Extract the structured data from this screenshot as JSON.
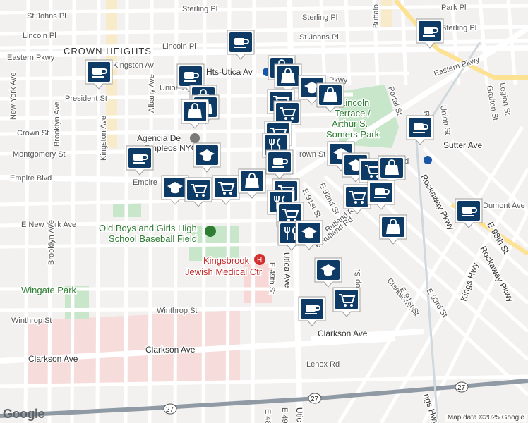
{
  "map": {
    "neighborhood": "CROWN HEIGHTS",
    "streets": {
      "sterling_1": "Sterling Pl",
      "sterling_2": "Sterling Pl",
      "sterling_3": "Sterling Pl",
      "st_johns_1": "St Johns Pl",
      "st_johns_2": "St Johns Pl",
      "lincoln_1": "Lincoln Pl",
      "lincoln_2": "Lincoln Pl",
      "eastern_pkwy_1": "Eastern Pkwy",
      "eastern_pkwy_2": "Eastern Pkwy",
      "eastern_pkwy_3": "Pkwy",
      "kingston_av": "Kingston Av",
      "union_1": "Union S",
      "president": "President St",
      "albany": "Albany Ave",
      "kingston_ave": "Kingston Ave",
      "brooklyn_1": "Brooklyn Ave",
      "ny_ave": "New York Ave",
      "crown": "Crown St",
      "montgomery": "Montgomery St",
      "empire_1": "Empire Blvd",
      "empire_2": "Empire",
      "e_ny_ave": "E New York Ave",
      "brooklyn_2": "Brooklyn Ave",
      "winthrop_1": "Winthrop St",
      "winthrop_2": "Winthrop St",
      "clarkson_1": "Clarkson Ave",
      "clarkson_2": "Clarkson Ave",
      "clarkson_3": "Clarkson Ave",
      "lenox": "Lenox Rd",
      "utica": "Utica Ave",
      "utica_2": "Utic",
      "e49": "E 49th St",
      "e49_2": "E 49",
      "e48": "E 48",
      "e91": "E 91st St",
      "e91_2": "E 91st St",
      "e92": "E 92nd St",
      "e93": "E 93rd St",
      "e98": "E 98th St",
      "rutland": "Rutland Rd",
      "rutland_2": "e Rutland Rd",
      "town": "rown St",
      "sutter": "Sutter Ave",
      "dumont": "Dumont Ave",
      "rockaway_1": "Rockaway Pkwy",
      "rockaway_2": "Rockaway Pkwy",
      "kings_hwy": "Kings Hwy",
      "kings_hwy_2": "ngs Hwy",
      "grafton": "Grafton St",
      "legion": "Legion St",
      "union_2": "Union St",
      "portal": "Portal St",
      "buffalo": "Buffalo",
      "park_pl": "Park Pl",
      "route": "27",
      "rd_rd": "d Rd",
      "ra": "Ra"
    },
    "places": {
      "subway": "n Hts-Utica Av",
      "agency": "Agencia De",
      "agency_2": "Empleos NYC",
      "park_name_1": "Lincoln",
      "park_name_2": "Terrace /",
      "park_name_3": "Arthur S.",
      "park_name_4": "Somers Park",
      "field_1": "Old Boys and Girls High",
      "field_2": "School Baseball Field",
      "hospital_1": "Kingsbrook",
      "hospital_2": "Jewish Medical Ctr",
      "wingate": "Wingate Park"
    },
    "colors": {
      "marker": "#0d3b66",
      "park": "#c8e6c9",
      "hospital_zone": "#f8d7d7",
      "highway": "#f5c94a"
    }
  },
  "markers": [
    {
      "icon": "coffee-icon"
    },
    {
      "icon": "coffee-icon"
    },
    {
      "icon": "coffee-icon"
    },
    {
      "icon": "coffee-icon"
    },
    {
      "icon": "shopping-bag-icon"
    },
    {
      "icon": "shopping-bag-icon"
    },
    {
      "icon": "shopping-bag-icon"
    },
    {
      "icon": "graduation-cap-icon"
    },
    {
      "icon": "coffee-icon"
    },
    {
      "icon": "shopping-bag-icon"
    },
    {
      "icon": "shopping-cart-icon"
    },
    {
      "icon": "shopping-bag-icon"
    },
    {
      "icon": "shopping-bag-icon"
    },
    {
      "icon": "shopping-cart-icon"
    },
    {
      "icon": "shopping-cart-icon"
    },
    {
      "icon": "restaurant-icon"
    },
    {
      "icon": "coffee-icon"
    },
    {
      "icon": "graduation-cap-icon"
    },
    {
      "icon": "coffee-icon"
    },
    {
      "icon": "graduation-cap-icon"
    },
    {
      "icon": "graduation-cap-icon"
    },
    {
      "icon": "shopping-cart-icon"
    },
    {
      "icon": "shopping-bag-icon"
    },
    {
      "icon": "shopping-cart-icon"
    },
    {
      "icon": "restaurant-icon"
    },
    {
      "icon": "shopping-cart-icon"
    },
    {
      "icon": "graduation-cap-icon"
    },
    {
      "icon": "shopping-cart-icon"
    },
    {
      "icon": "shopping-cart-icon"
    },
    {
      "icon": "shopping-bag-icon"
    },
    {
      "icon": "shopping-cart-icon"
    },
    {
      "icon": "coffee-icon"
    },
    {
      "icon": "coffee-icon"
    },
    {
      "icon": "shopping-bag-icon"
    },
    {
      "icon": "restaurant-icon"
    },
    {
      "icon": "graduation-cap-icon"
    },
    {
      "icon": "graduation-cap-icon"
    },
    {
      "icon": "shopping-cart-icon"
    },
    {
      "icon": "coffee-icon"
    }
  ],
  "footer": {
    "logo": "Google",
    "attribution": "Map data ©2025 Google"
  }
}
